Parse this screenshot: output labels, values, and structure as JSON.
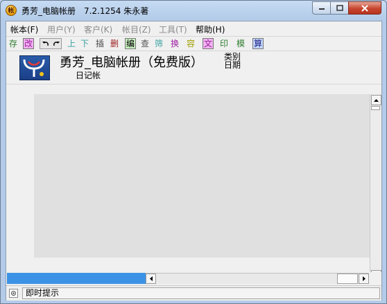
{
  "window": {
    "title": "勇芳_电脑帐册　7.2.1254 朱永著",
    "icon_glyph": "帐"
  },
  "menu": [
    {
      "label": "帐本(F)",
      "enabled": true
    },
    {
      "label": "用户(Y)",
      "enabled": false
    },
    {
      "label": "客户(K)",
      "enabled": false
    },
    {
      "label": "帐目(Z)",
      "enabled": false
    },
    {
      "label": "工具(T)",
      "enabled": false
    },
    {
      "label": "帮助(H)",
      "enabled": true
    }
  ],
  "toolbar": {
    "save": "存",
    "modify": "改",
    "undo_icon": "undo-icon",
    "redo_icon": "redo-icon",
    "up": "上",
    "down": "下",
    "insert": "插",
    "delete": "删",
    "edit": "编",
    "find": "查",
    "filter": "筛",
    "replace": "换",
    "capacity": "容",
    "text": "文",
    "print": "印",
    "template": "模",
    "calculate": "算"
  },
  "header": {
    "app_name": "勇芳_电脑帐册（免费版）",
    "category_label": "类别",
    "date_label": "日期",
    "book_type": "日记帐"
  },
  "status": {
    "hint": "即时提示"
  },
  "colors": {
    "accent_progress": "#3c93e6",
    "toolbar_green": "#c8f0c0",
    "toolbar_pink": "#f0b4f0",
    "toolbar_blue": "#c4d8ff"
  }
}
